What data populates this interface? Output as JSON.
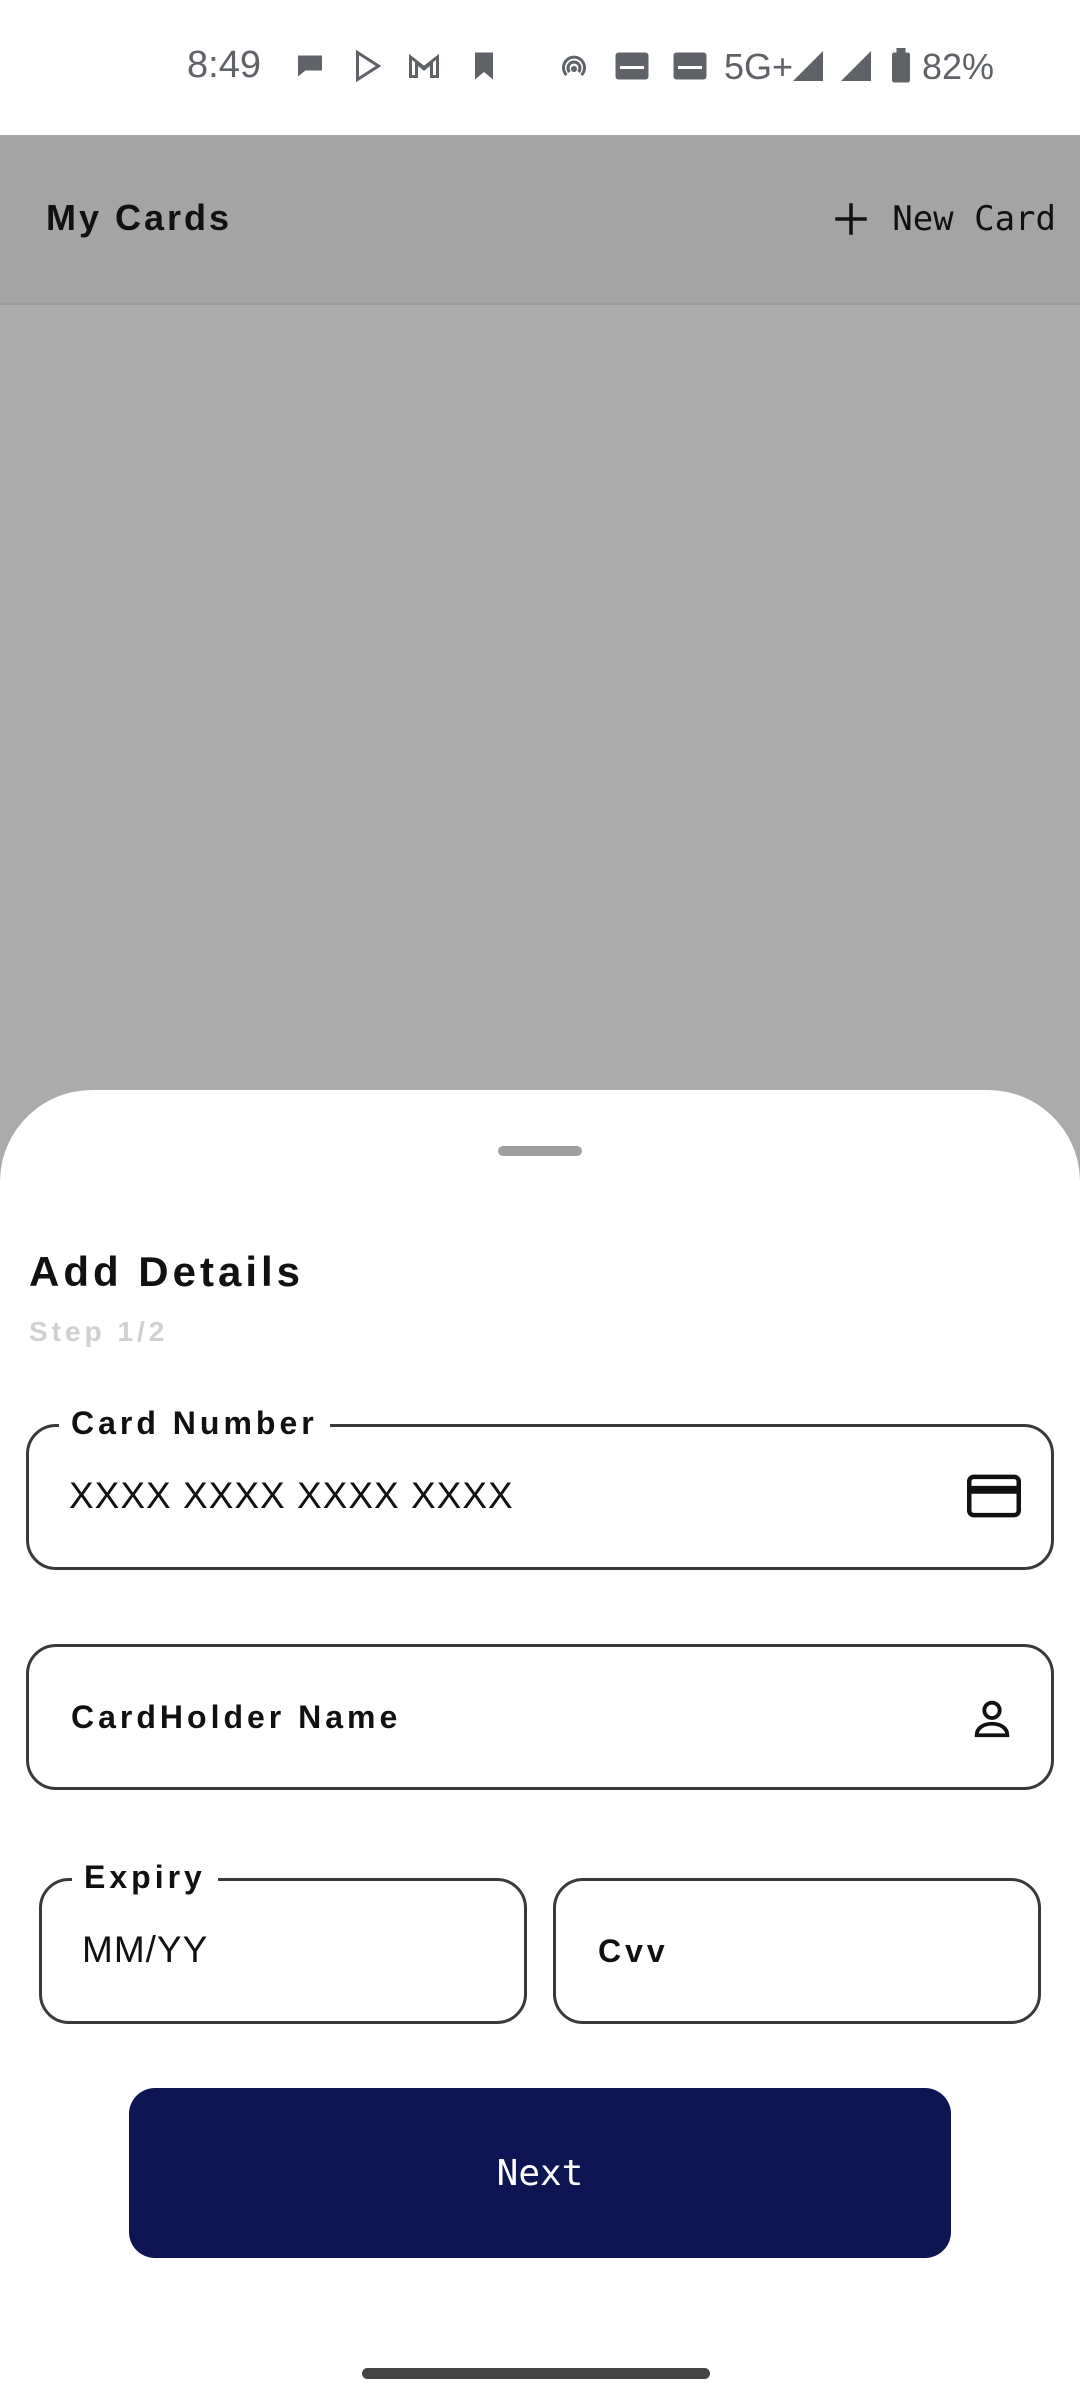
{
  "status_bar": {
    "time": "8:49",
    "network": "5G+",
    "battery": "82%",
    "icons": [
      "chat-icon",
      "play-store-icon",
      "gmail-icon",
      "bookmark-icon",
      "hotspot-icon",
      "volte-lte-icon",
      "volte-nr-icon",
      "signal-icon",
      "signal-icon",
      "battery-icon"
    ]
  },
  "app_bar": {
    "title": "My Cards",
    "new_card_label": "New Card"
  },
  "sheet": {
    "title": "Add Details",
    "subtitle": "Step 1/2",
    "card_number": {
      "label": "Card Number",
      "value": "XXXX XXXX XXXX XXXX",
      "icon": "credit-card-icon"
    },
    "cardholder": {
      "placeholder": "CardHolder Name",
      "icon": "person-icon"
    },
    "expiry": {
      "label": "Expiry",
      "value": "MM/YY"
    },
    "cvv": {
      "placeholder": "Cvv"
    },
    "next_label": "Next"
  },
  "colors": {
    "scrim": "#ababab",
    "button": "#0d1552",
    "subtitle": "#d0d0d0"
  }
}
